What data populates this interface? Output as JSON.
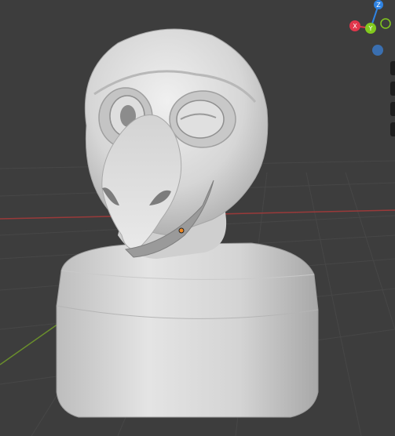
{
  "viewport": {
    "background": "#3d3d3d",
    "model_name": "bird-head-bust",
    "model_color": "#d9d9d9"
  },
  "gizmo": {
    "axes": [
      {
        "label": "Z",
        "color": "#2f83e3"
      },
      {
        "label": "X",
        "color": "#e0364b"
      },
      {
        "label": "Y",
        "color": "#82c91e"
      }
    ],
    "persp_toggle_color": "#3a6fb0"
  },
  "side_toolbar": {
    "icons": [
      "hand-pan-icon",
      "zoom-icon",
      "camera-icon",
      "grid-icon"
    ]
  }
}
